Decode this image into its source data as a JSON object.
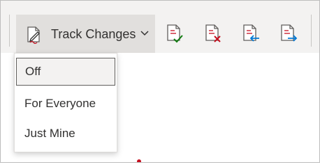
{
  "toolbar": {
    "track_changes_label": "Track Changes",
    "track_changes_icon": "track-changes-icon",
    "dropdown_icon": "chevron-down-icon",
    "icons": [
      "accept-change-icon",
      "reject-change-icon",
      "previous-change-icon",
      "next-change-icon"
    ]
  },
  "menu": {
    "items": [
      {
        "label": "Off",
        "selected": true
      },
      {
        "label": "For Everyone",
        "selected": false
      },
      {
        "label": "Just Mine",
        "selected": false
      }
    ]
  },
  "colors": {
    "ribbon_bg": "#f3f2f1",
    "button_active_bg": "#e1dfdd",
    "accept_green": "#107c10",
    "reject_red": "#c50f1f",
    "nav_blue": "#0078d4"
  }
}
